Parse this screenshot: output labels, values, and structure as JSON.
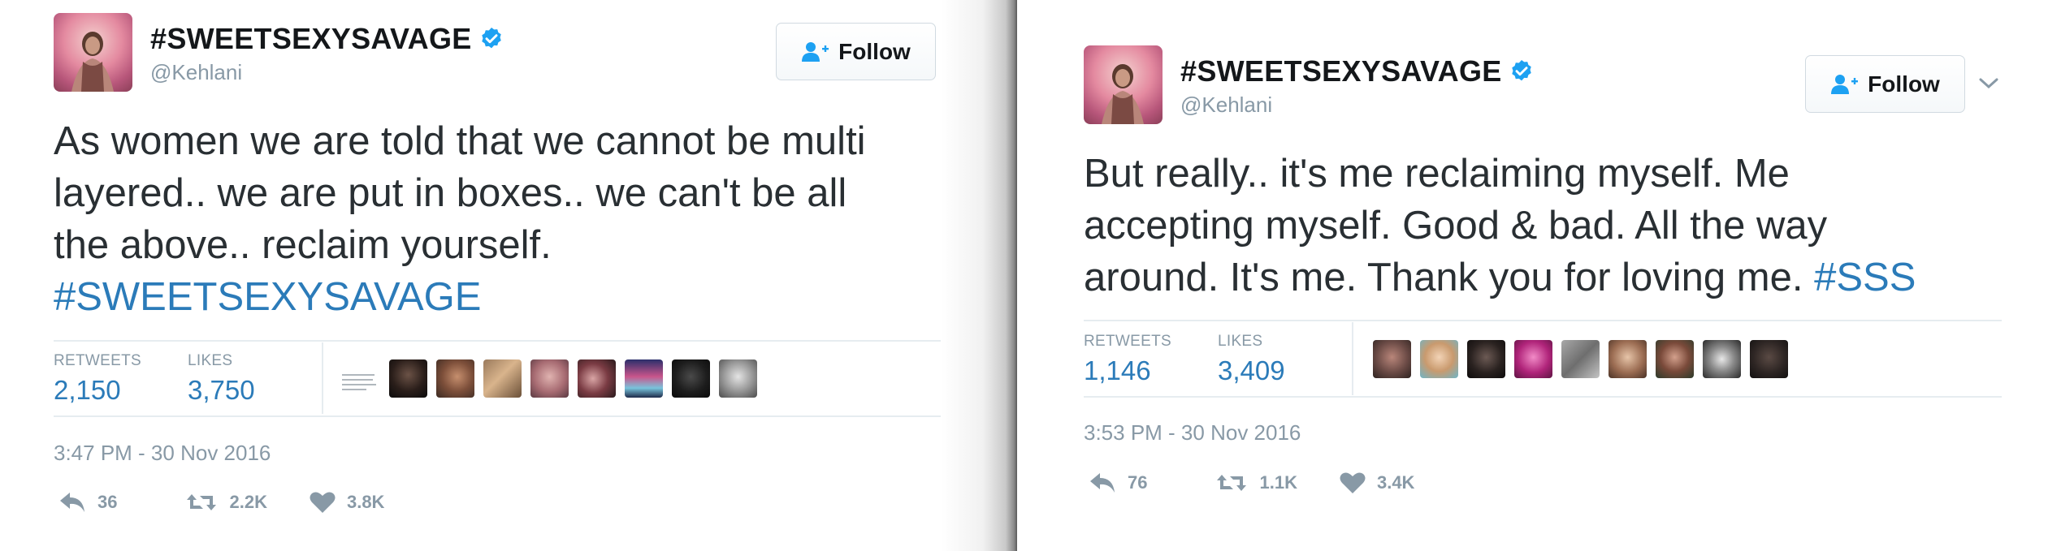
{
  "tweets": [
    {
      "display_name": "#SWEETSEXYSAVAGE",
      "handle": "@Kehlani",
      "follow_label": "Follow",
      "text_plain": "As women we are told that we cannot be multi layered.. we are put in boxes.. we can't be all the above.. reclaim yourself.",
      "text_line1": "As women we are told that we cannot be multi",
      "text_line2": "layered.. we are put in boxes.. we can't be all",
      "text_line3": "the above.. reclaim yourself.",
      "hashtag": "#SWEETSEXYSAVAGE",
      "retweets_label": "RETWEETS",
      "retweets_value": "2,150",
      "likes_label": "LIKES",
      "likes_value": "3,750",
      "timestamp": "3:47 PM - 30 Nov 2016",
      "reply_count": "36",
      "retweet_count": "2.2K",
      "like_count": "3.8K"
    },
    {
      "display_name": "#SWEETSEXYSAVAGE",
      "handle": "@Kehlani",
      "follow_label": "Follow",
      "text_line1": "But really.. it's me reclaiming myself. Me",
      "text_line2": "accepting myself. Good & bad. All the way",
      "text_line3": "around. It's me. Thank you for loving me.",
      "hashtag": "#SSS",
      "retweets_label": "RETWEETS",
      "retweets_value": "1,146",
      "likes_label": "LIKES",
      "likes_value": "3,409",
      "timestamp": "3:53 PM - 30 Nov 2016",
      "reply_count": "76",
      "retweet_count": "1.1K",
      "like_count": "3.4K"
    }
  ],
  "colors": {
    "link": "#2b7bb9",
    "muted": "#8899a6",
    "text": "#292f33",
    "verified": "#1da1f2"
  },
  "icons": [
    "verified-badge-icon",
    "follow-person-plus-icon",
    "chevron-down-icon",
    "reply-icon",
    "retweet-icon",
    "heart-icon"
  ]
}
